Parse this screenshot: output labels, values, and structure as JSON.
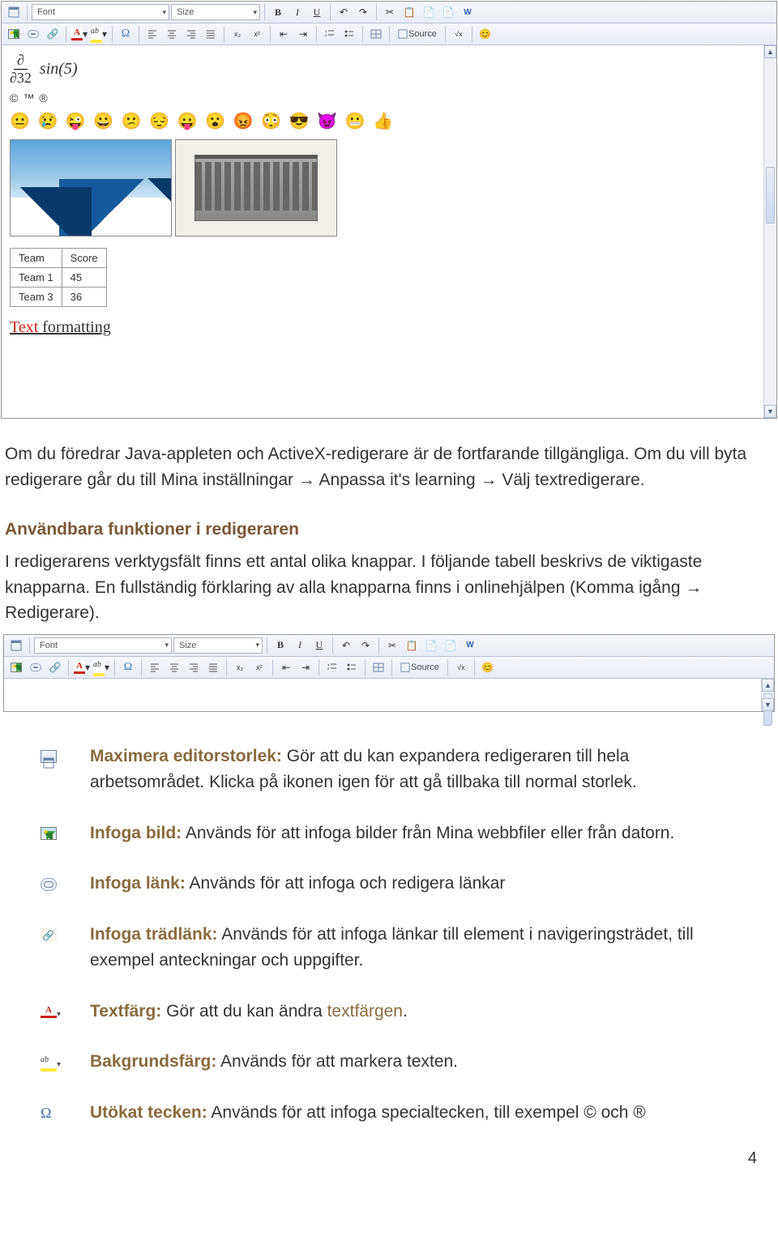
{
  "toolbars": {
    "font_label": "Font",
    "size_label": "Size",
    "bold": "B",
    "italic": "I",
    "underline": "U",
    "source": "Source"
  },
  "editor_content": {
    "math_partial": "∂",
    "math_denominator": "∂32",
    "math_sin": "sin(5)",
    "symbols": "©™®",
    "table_headers": [
      "Team",
      "Score"
    ],
    "table_rows": [
      [
        "Team 1",
        "45"
      ],
      [
        "Team 3",
        "36"
      ]
    ],
    "text_formatting_red": "Text",
    "text_formatting_rest": " formatting"
  },
  "paragraphs": {
    "p1": "Om du föredrar Java-appleten och ActiveX-redigerare är de fortfarande tillgängliga. Om du vill byta redigerare går du till Mina inställningar ",
    "p1_step1": " Anpassa it's learning ",
    "p1_step2": " Välj textredigerare."
  },
  "section_heading": "Användbara funktioner i redigeraren",
  "section_text": {
    "s1": "I redigerarens verktygsfält finns ett antal olika knappar. I följande tabell beskrivs de viktigaste knapparna. En fullständig förklaring av alla knapparna finns i onlinehjälpen (Komma igång ",
    "s2": " Redigerare)."
  },
  "descriptions": [
    {
      "label": "Maximera editorstorlek:",
      "body": " Gör att du kan expandera redigeraren till hela arbetsområdet. Klicka på ikonen igen för att gå tillbaka till normal storlek."
    },
    {
      "label": "Infoga bild:",
      "body": " Används för att infoga bilder från Mina webbfiler eller från datorn."
    },
    {
      "label": "Infoga länk:",
      "body": " Används för att infoga och redigera länkar"
    },
    {
      "label": "Infoga trädlänk:",
      "body": " Används för att infoga länkar till element i navigeringsträdet, till exempel anteckningar och uppgifter."
    },
    {
      "label": "Textfärg:",
      "body_pre": " Gör att du kan ändra ",
      "colored": "textfärgen",
      "body_post": "."
    },
    {
      "label": "Bakgrundsfärg:",
      "body": " Används för att markera texten."
    },
    {
      "label": "Utökat tecken:",
      "body": " Används för att infoga specialtecken, till exempel © och ®"
    }
  ],
  "page_number": "4"
}
